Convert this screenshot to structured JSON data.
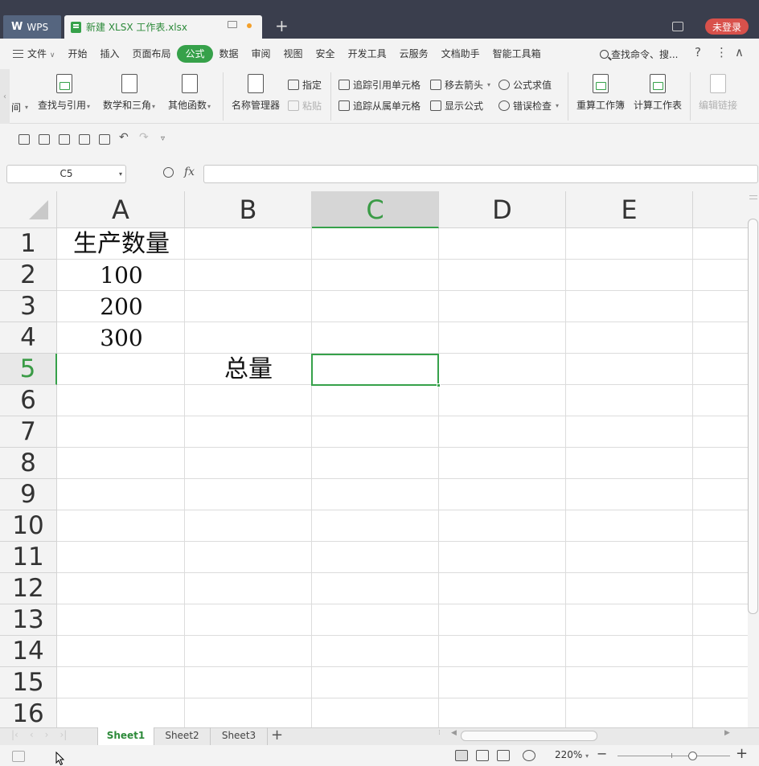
{
  "titlebar": {
    "app_label": "WPS",
    "doc_tab_title": "新建 XLSX 工作表.xlsx",
    "new_tab": "+",
    "login_label": "未登录"
  },
  "menu": {
    "items": [
      "文件",
      "开始",
      "插入",
      "页面布局",
      "公式",
      "数据",
      "审阅",
      "视图",
      "安全",
      "开发工具",
      "云服务",
      "文档助手",
      "智能工具箱"
    ],
    "active": "公式",
    "search_placeholder": "查找命令、搜..."
  },
  "ribbon": {
    "time_label": "间",
    "lookup": "查找与引用",
    "math": "数学和三角",
    "other_funcs": "其他函数",
    "name_manager": "名称管理器",
    "assign": "指定",
    "paste": "粘贴",
    "trace_precedents": "追踪引用单元格",
    "trace_dependents": "追踪从属单元格",
    "remove_arrows": "移去箭头",
    "show_formulas": "显示公式",
    "evaluate_formula": "公式求值",
    "error_check": "错误检查",
    "recalc_workbook": "重算工作簿",
    "calc_sheet": "计算工作表",
    "edit_links": "编辑链接"
  },
  "formula_bar": {
    "name_box": "C5",
    "fx_label": "fx",
    "value": ""
  },
  "sheet": {
    "columns": [
      "A",
      "B",
      "C",
      "D",
      "E"
    ],
    "selected_column": "C",
    "rows": [
      "1",
      "2",
      "3",
      "4",
      "5",
      "6",
      "7",
      "8",
      "9",
      "10",
      "11",
      "12",
      "13",
      "14",
      "15",
      "16"
    ],
    "selected_row": "5",
    "cells": {
      "A1": "生产数量",
      "A2": "100",
      "A3": "200",
      "A4": "300",
      "B5": "总量"
    }
  },
  "tabs": {
    "sheets": [
      "Sheet1",
      "Sheet2",
      "Sheet3"
    ],
    "active": "Sheet1",
    "add": "+"
  },
  "status": {
    "zoom": "220%"
  }
}
